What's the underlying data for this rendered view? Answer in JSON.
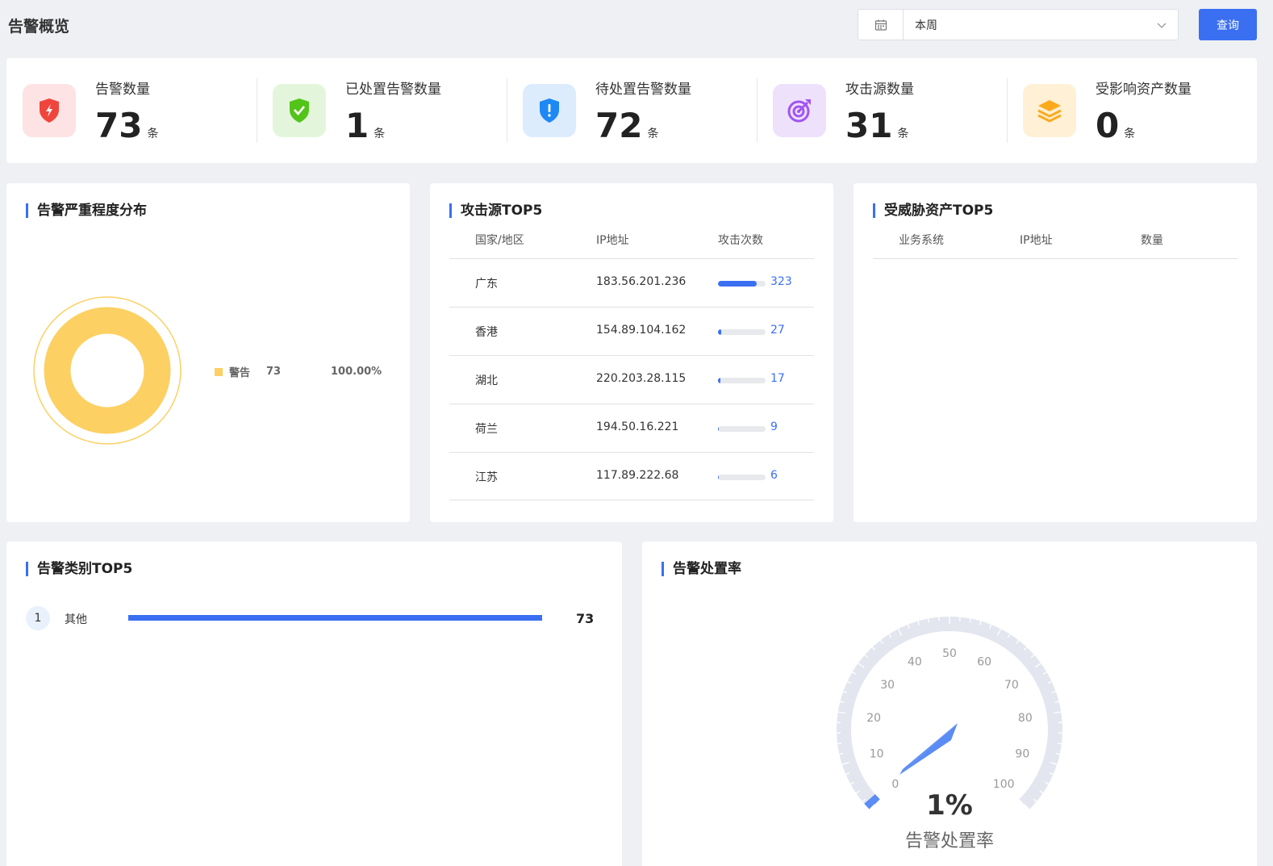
{
  "header": {
    "title": "告警概览",
    "date_range": "本周",
    "query_label": "查询"
  },
  "stats": [
    {
      "label": "告警数量",
      "value": "73",
      "unit": "条",
      "icon": "shield-bolt-icon",
      "color": "#f0453c",
      "bg": "#fde3e3"
    },
    {
      "label": "已处置告警数量",
      "value": "1",
      "unit": "条",
      "icon": "shield-check-icon",
      "color": "#52c41a",
      "bg": "#e3f6dc"
    },
    {
      "label": "待处置告警数量",
      "value": "72",
      "unit": "条",
      "icon": "shield-exclamation-icon",
      "color": "#1e88f5",
      "bg": "#dcecfd"
    },
    {
      "label": "攻击源数量",
      "value": "31",
      "unit": "条",
      "icon": "target-icon",
      "color": "#a155f0",
      "bg": "#eee1fc"
    },
    {
      "label": "受影响资产数量",
      "value": "0",
      "unit": "条",
      "icon": "layers-icon",
      "color": "#fbaa1e",
      "bg": "#fff0d6"
    }
  ],
  "severity": {
    "title": "告警严重程度分布",
    "items": [
      {
        "name": "警告",
        "count": "73",
        "percent": "100.00%",
        "color": "#fcd062"
      }
    ]
  },
  "attack_sources": {
    "title": "攻击源TOP5",
    "headers": [
      "国家/地区",
      "IP地址",
      "攻击次数"
    ],
    "rows": [
      {
        "region": "广东",
        "ip": "183.56.201.236",
        "count": 323
      },
      {
        "region": "香港",
        "ip": "154.89.104.162",
        "count": 27
      },
      {
        "region": "湖北",
        "ip": "220.203.28.115",
        "count": 17
      },
      {
        "region": "荷兰",
        "ip": "194.50.16.221",
        "count": 9
      },
      {
        "region": "江苏",
        "ip": "117.89.222.68",
        "count": 6
      }
    ]
  },
  "threat_assets": {
    "title": "受威胁资产TOP5",
    "headers": [
      "业务系统",
      "IP地址",
      "数量"
    ],
    "rows": []
  },
  "categories": {
    "title": "告警类别TOP5",
    "rows": [
      {
        "rank": "1",
        "name": "其他",
        "value": "73"
      }
    ]
  },
  "rate": {
    "title": "告警处置率",
    "value": 1,
    "value_label": "1%",
    "caption": "告警处置率",
    "ticks": [
      "0",
      "10",
      "20",
      "30",
      "40",
      "50",
      "60",
      "70",
      "80",
      "90",
      "100"
    ]
  }
}
